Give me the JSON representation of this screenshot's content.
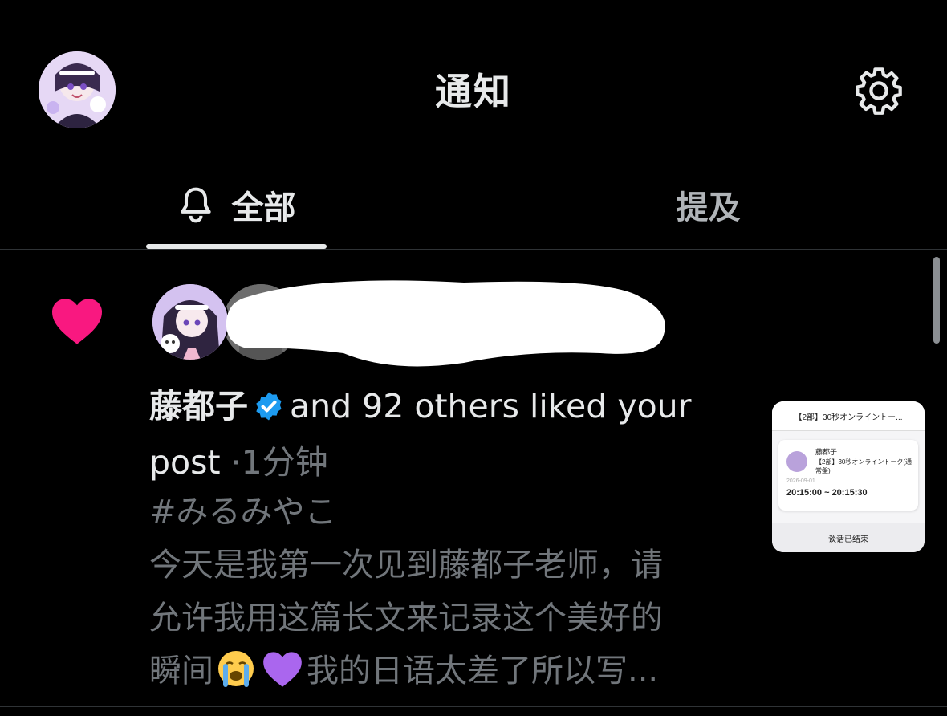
{
  "header": {
    "title": "通知",
    "avatar_icon": "user-avatar",
    "settings_icon": "gear-icon"
  },
  "tabs": [
    {
      "label": "全部",
      "icon": "bell-icon",
      "active": true
    },
    {
      "label": "提及",
      "active": false
    }
  ],
  "notification": {
    "type_icon": "heart-icon",
    "type_color": "#f91880",
    "user_name": "藤都子",
    "verified": true,
    "action_text": "and 92 others liked your post",
    "separator": "·",
    "time": "1分钟",
    "snippet_lines": [
      "#みるみやこ",
      "今天是我第一次见到藤都子老师，请",
      "允许我用这篇长文来记录这个美好的"
    ],
    "snippet_last_prefix": "瞬间",
    "snippet_last_suffix": "我的日语太差了所以写...",
    "emojis": [
      "crying-face-emoji",
      "purple-heart-emoji"
    ]
  },
  "thumbnail": {
    "header": "【2部】30秒オンライントー...",
    "name": "藤都子",
    "event": "【2部】30秒オンライントーク(通常盤)",
    "date": "2026-09-01",
    "time_range": "20:15:00 ~ 20:15:30",
    "footer": "谈话已结束"
  },
  "colors": {
    "background": "#000000",
    "text_primary": "#e7e9ea",
    "text_secondary": "#71767b",
    "like_pink": "#f91880",
    "verified_blue": "#1d9bf0"
  }
}
